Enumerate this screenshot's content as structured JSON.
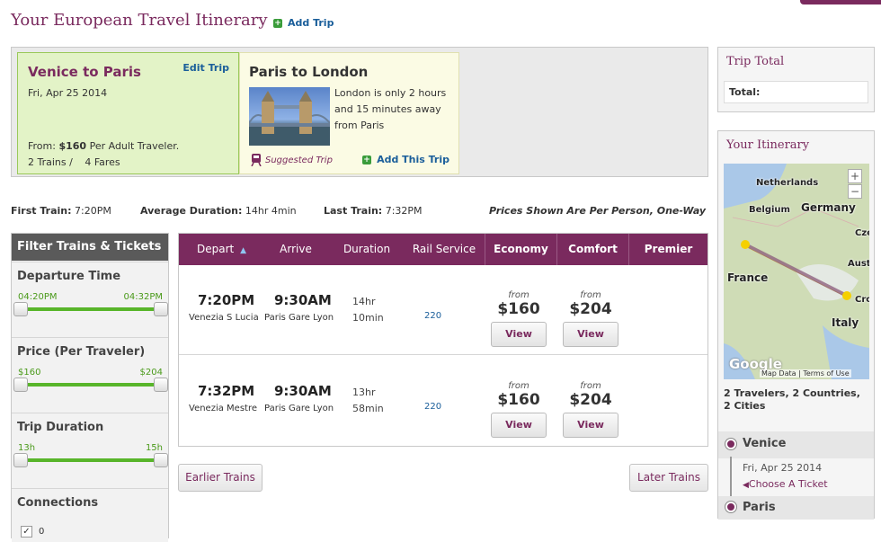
{
  "header": {
    "title": "Your European Travel Itinerary",
    "add_trip": "Add Trip",
    "plus_icon": "+"
  },
  "trips": [
    {
      "title": "Venice to Paris",
      "edit": "Edit Trip",
      "date": "Fri, Apr 25 2014",
      "from_prefix": "From:",
      "from_price": "$160",
      "from_suffix": "Per Adult Traveler.",
      "trains": "2 Trains /",
      "fares": "4 Fares"
    },
    {
      "title": "Paris to London",
      "desc": "London is only 2 hours and 15 minutes away from Paris",
      "suggested": "Suggested Trip",
      "add": "Add This Trip"
    }
  ],
  "stats": {
    "first_label": "First Train:",
    "first_value": "7:20PM",
    "avg_label": "Average Duration:",
    "avg_value": "14hr 4min",
    "last_label": "Last Train:",
    "last_value": "7:32PM",
    "note": "Prices Shown Are Per Person, One-Way"
  },
  "filters": {
    "heading": "Filter Trains & Tickets",
    "sections": [
      {
        "title": "Departure Time",
        "min": "04:20PM",
        "max": "04:32PM"
      },
      {
        "title": "Price (Per Traveler)",
        "min": "$160",
        "max": "$204"
      },
      {
        "title": "Trip Duration",
        "min": "13h",
        "max": "15h"
      },
      {
        "title": "Connections",
        "option": "0"
      }
    ]
  },
  "columns": {
    "depart": "Depart",
    "sort_icon": "▲",
    "arrive": "Arrive",
    "duration": "Duration",
    "rail": "Rail Service",
    "economy": "Economy",
    "comfort": "Comfort",
    "premier": "Premier"
  },
  "rows": [
    {
      "depart": "7:20PM",
      "depart_station": "Venezia S Lucia",
      "arrive": "9:30AM",
      "arrive_station": "Paris Gare Lyon",
      "dur_h": "14hr",
      "dur_m": "10min",
      "service": "220",
      "econ_from": "from",
      "econ_price": "$160",
      "comf_from": "from",
      "comf_price": "$204",
      "view": "View"
    },
    {
      "depart": "7:32PM",
      "depart_station": "Venezia Mestre",
      "arrive": "9:30AM",
      "arrive_station": "Paris Gare Lyon",
      "dur_h": "13hr",
      "dur_m": "58min",
      "service": "220",
      "econ_from": "from",
      "econ_price": "$160",
      "comf_from": "from",
      "comf_price": "$204",
      "view": "View"
    }
  ],
  "pager": {
    "earlier": "Earlier Trains",
    "later": "Later Trains"
  },
  "trip_total": {
    "title": "Trip Total",
    "total_label": "Total:"
  },
  "itinerary": {
    "title": "Your Itinerary",
    "map_labels": {
      "netherlands": "Netherlands",
      "belgium": "Belgium",
      "germany": "Germany",
      "cze": "Cze",
      "france": "France",
      "aust": "Aust",
      "cro": "Cro",
      "italy": "Italy"
    },
    "zoom_in": "+",
    "zoom_out": "−",
    "google": "Google",
    "map_data": "Map Data",
    "terms": "Terms of Use",
    "summary": "2 Travelers, 2 Countries, 2 Cities",
    "stop1": "Venice",
    "stop1_date": "Fri, Apr 25 2014",
    "choose_ticket": "Choose A Ticket",
    "stop2": "Paris"
  },
  "colors": {
    "brand": "#7a2a5e",
    "link": "#1a5e9a",
    "green": "#58b52a"
  }
}
